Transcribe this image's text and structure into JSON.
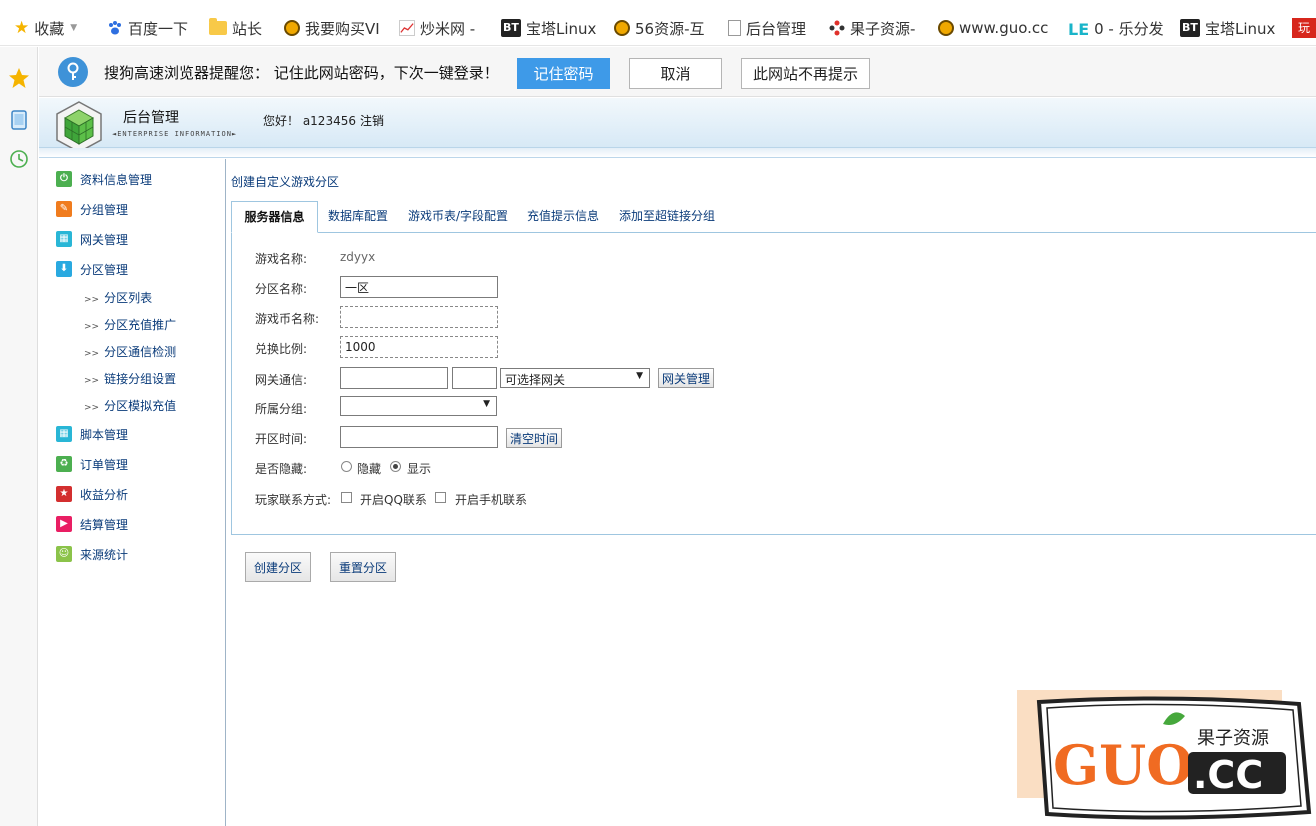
{
  "bookmarks": [
    {
      "label": "收藏",
      "icon": "star-icon"
    },
    {
      "label": "百度一下",
      "icon": "paw-icon"
    },
    {
      "label": "站长",
      "icon": "folder-icon"
    },
    {
      "label": "我要购买VI",
      "icon": "smiley-icon"
    },
    {
      "label": "炒米网 -",
      "icon": "chart-icon"
    },
    {
      "label": "宝塔Linux",
      "icon": "bt-icon"
    },
    {
      "label": "56资源-互",
      "icon": "smiley-icon"
    },
    {
      "label": "后台管理",
      "icon": "document-icon"
    },
    {
      "label": "果子资源-",
      "icon": "diamond-icon"
    },
    {
      "label": "www.guo.cc",
      "icon": "smiley-icon"
    },
    {
      "label": "0 - 乐分发",
      "icon": "le-icon"
    },
    {
      "label": "宝塔Linux",
      "icon": "bt-icon"
    },
    {
      "label": "",
      "icon": "red-logo-icon"
    }
  ],
  "bt_text": "BT",
  "le_text": "LE",
  "red_text": "玩",
  "password_bar": {
    "message": "搜狗高速浏览器提醒您： 记住此网站密码，下次一键登录！",
    "remember": "记住密码",
    "cancel": "取消",
    "never": "此网站不再提示"
  },
  "header": {
    "title": "后台管理",
    "subtitle": "◄ENTERPRISE INFORMATION►",
    "greeting": "您好！ a123456",
    "logout": "注销"
  },
  "sidebar": {
    "items": [
      {
        "label": "资料信息管理",
        "color": "#4caf50",
        "glyph": "⏻"
      },
      {
        "label": "分组管理",
        "color": "#f07c1e",
        "glyph": "✎"
      },
      {
        "label": "网关管理",
        "color": "#29b6d6",
        "glyph": "▦"
      },
      {
        "label": "分区管理",
        "color": "#29a9e0",
        "glyph": "⬇"
      }
    ],
    "sub_items": [
      "分区列表",
      "分区充值推广",
      "分区通信检测",
      "链接分组设置",
      "分区模拟充值"
    ],
    "items_after": [
      {
        "label": "脚本管理",
        "color": "#29b6d6",
        "glyph": "▦"
      },
      {
        "label": "订单管理",
        "color": "#4caf50",
        "glyph": "♻"
      },
      {
        "label": "收益分析",
        "color": "#d32f2f",
        "glyph": "★"
      },
      {
        "label": "结算管理",
        "color": "#e91e63",
        "glyph": "▶"
      },
      {
        "label": "来源统计",
        "color": "#8bc34a",
        "glyph": "☺"
      }
    ],
    "arrow": ">>"
  },
  "main": {
    "breadcrumb": "创建自定义游戏分区",
    "tabs": [
      "服务器信息",
      "数据库配置",
      "游戏币表/字段配置",
      "充值提示信息",
      "添加至超链接分组"
    ],
    "form": {
      "game_name_label": "游戏名称:",
      "game_name_value": "zdyyx",
      "zone_name_label": "分区名称:",
      "zone_name_value": "一区",
      "currency_label": "游戏币名称:",
      "currency_value": "",
      "ratio_label": "兑换比例:",
      "ratio_value": "1000",
      "gateway_label": "网关通信:",
      "gateway_select": "可选择网关",
      "gateway_btn": "网关管理",
      "group_label": "所属分组:",
      "open_time_label": "开区时间:",
      "clear_time_btn": "清空时间",
      "hidden_label": "是否隐藏:",
      "hide_opt": "隐藏",
      "show_opt": "显示",
      "contact_label": "玩家联系方式:",
      "qq_opt": "开启QQ联系",
      "phone_opt": "开启手机联系"
    },
    "create_btn": "创建分区",
    "reset_btn": "重置分区"
  },
  "watermark": {
    "brand": "GUO",
    "tld": ".CC",
    "name": "果子资源"
  }
}
